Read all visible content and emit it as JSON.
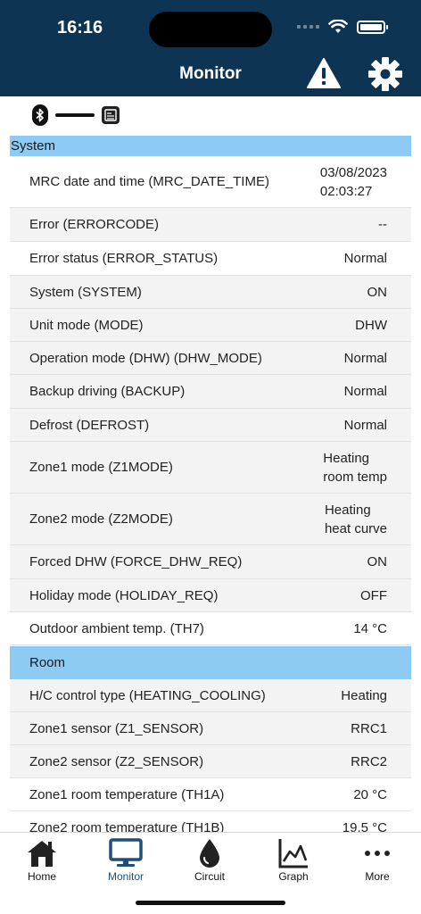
{
  "status_bar": {
    "time": "16:16"
  },
  "header": {
    "title": "Monitor"
  },
  "colors": {
    "header_bg": "#0d3553",
    "section_bg": "#8ecbf4",
    "active_tab": "#1f4e79"
  },
  "icons": {
    "warning": "warning-triangle-icon",
    "settings": "gear-icon",
    "bluetooth": "bluetooth-icon",
    "unit": "unit-icon"
  },
  "sections": [
    {
      "title": "System",
      "rows": [
        {
          "label": "MRC date and time (MRC_DATE_TIME)",
          "value": "03/08/2023\n02:03:27"
        },
        {
          "label": "Error (ERRORCODE)",
          "value": "--"
        },
        {
          "label": "Error status (ERROR_STATUS)",
          "value": "Normal"
        },
        {
          "label": "System (SYSTEM)",
          "value": "ON"
        },
        {
          "label": "Unit mode (MODE)",
          "value": "DHW"
        },
        {
          "label": "Operation mode (DHW) (DHW_MODE)",
          "value": "Normal"
        },
        {
          "label": "Backup driving (BACKUP)",
          "value": "Normal"
        },
        {
          "label": "Defrost (DEFROST)",
          "value": "Normal"
        },
        {
          "label": "Zone1 mode (Z1MODE)",
          "value": "Heating\nroom temp"
        },
        {
          "label": "Zone2 mode (Z2MODE)",
          "value": "Heating\nheat curve"
        },
        {
          "label": "Forced DHW (FORCE_DHW_REQ)",
          "value": "ON"
        },
        {
          "label": "Holiday mode (HOLIDAY_REQ)",
          "value": "OFF"
        },
        {
          "label": "Outdoor ambient temp. (TH7)",
          "value": "14 °C"
        }
      ]
    },
    {
      "title": "Room",
      "rows": [
        {
          "label": "H/C control type (HEATING_COOLING)",
          "value": "Heating"
        },
        {
          "label": "Zone1 sensor (Z1_SENSOR)",
          "value": "RRC1"
        },
        {
          "label": "Zone2 sensor (Z2_SENSOR)",
          "value": "RRC2"
        },
        {
          "label": "Zone1 room temperature (TH1A)",
          "value": "20 °C"
        },
        {
          "label": "Zone2 room temperature (TH1B)",
          "value": "19.5 °C"
        }
      ]
    }
  ],
  "tabs": [
    {
      "label": "Home",
      "icon": "home-icon"
    },
    {
      "label": "Monitor",
      "icon": "monitor-icon",
      "active": true
    },
    {
      "label": "Circuit",
      "icon": "water-drop-icon"
    },
    {
      "label": "Graph",
      "icon": "graph-icon"
    },
    {
      "label": "More",
      "icon": "more-icon"
    }
  ]
}
